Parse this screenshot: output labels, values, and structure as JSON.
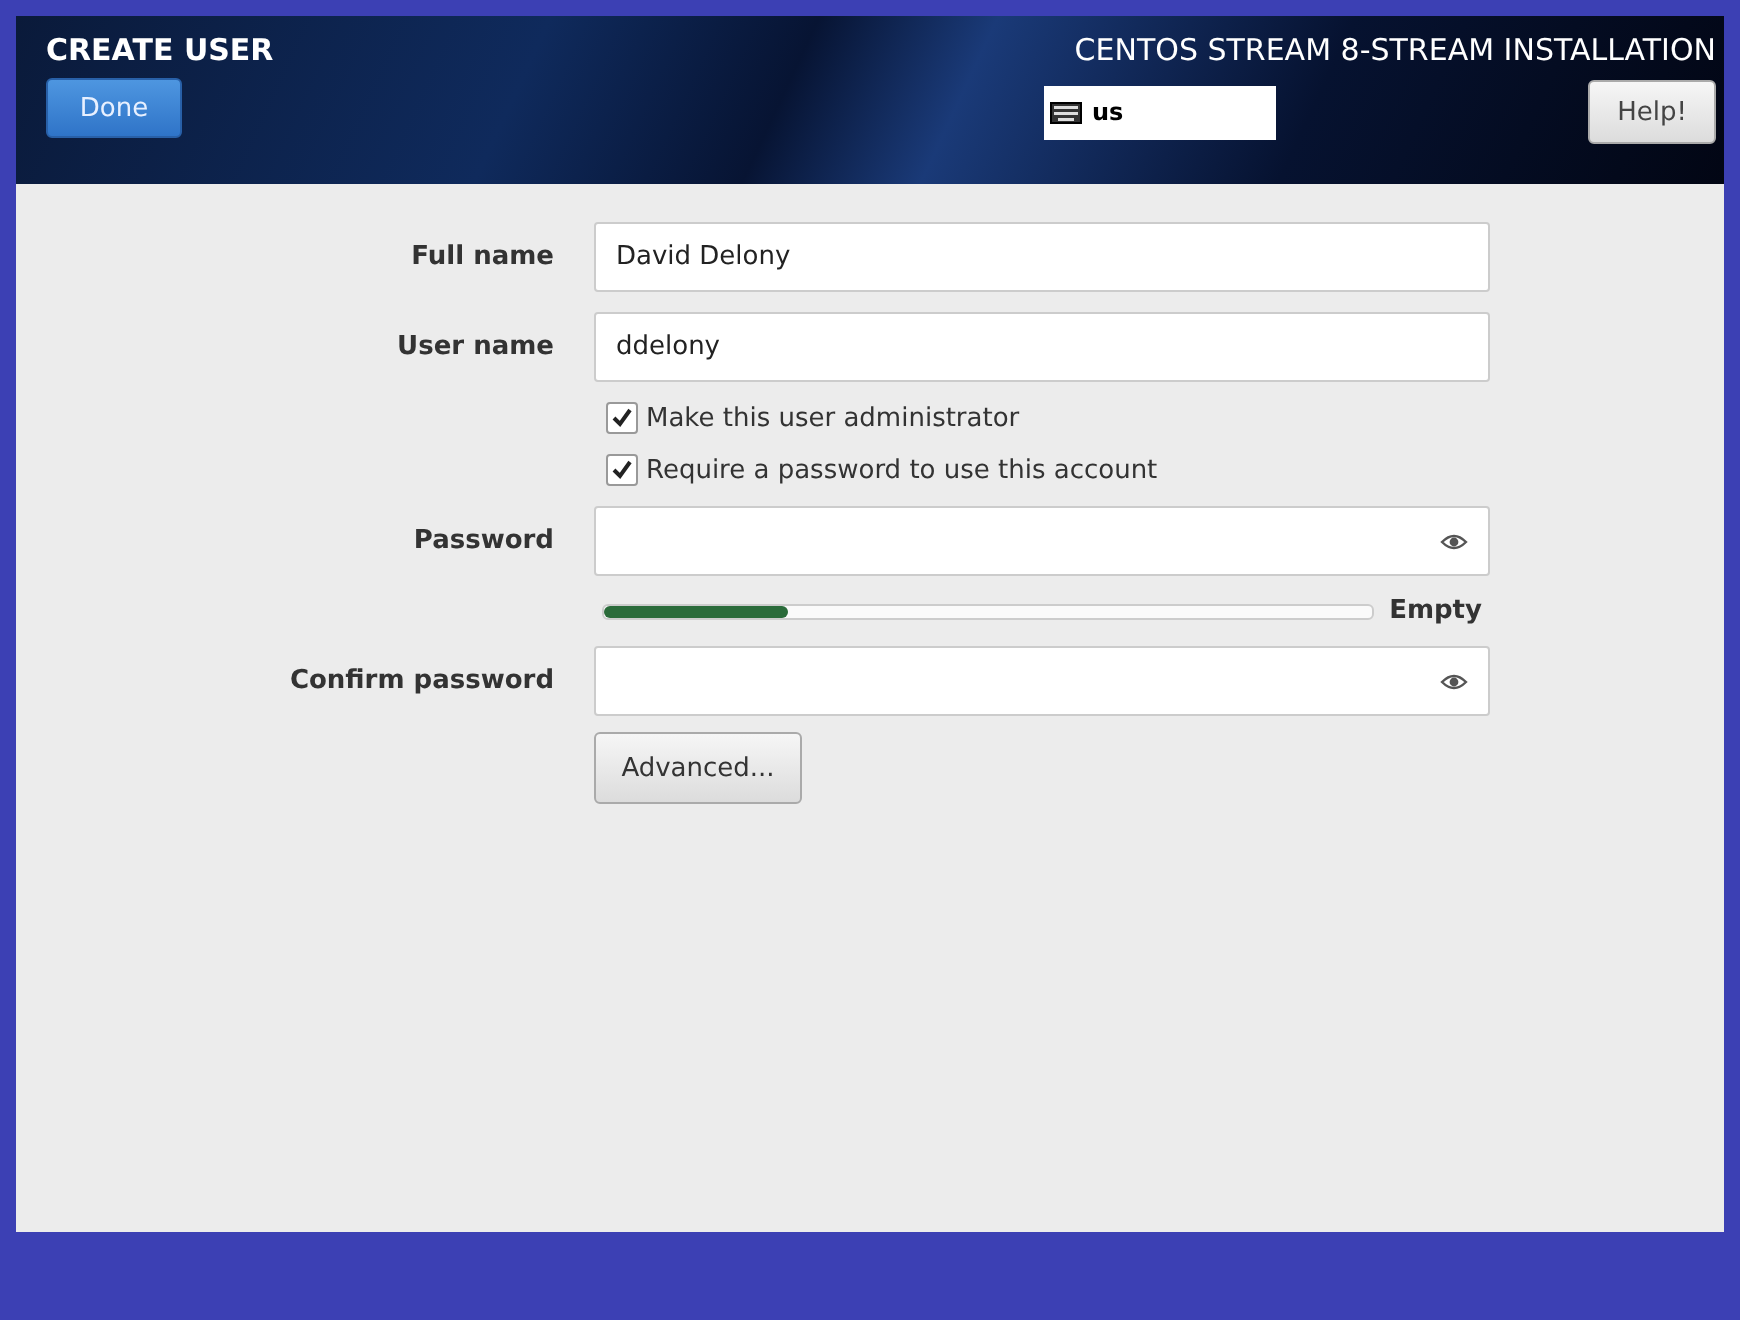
{
  "header": {
    "title": "CREATE USER",
    "done_button": "Done",
    "product": "CENTOS STREAM 8-STREAM INSTALLATION",
    "keyboard_layout": "us",
    "help_button": "Help!"
  },
  "fields": [
    {
      "label": "Full name",
      "value": "David Delony",
      "kind": "text"
    },
    {
      "label": "User name",
      "value": "ddelony",
      "kind": "text"
    }
  ],
  "checkboxes": [
    {
      "label": "Make this user administrator",
      "checked": true
    },
    {
      "label": "Require a password to use this account",
      "checked": true
    }
  ],
  "password": {
    "label": "Password"
  },
  "strength": {
    "level": 0.24,
    "reading": "Empty"
  },
  "confirm": {
    "label": "Confirm password"
  },
  "advanced_button": "Advanced..."
}
